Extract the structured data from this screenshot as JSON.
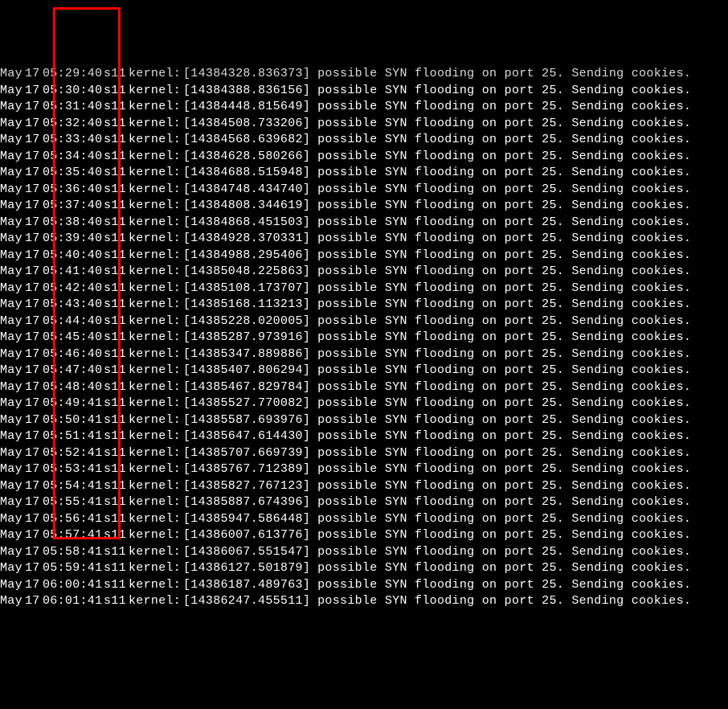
{
  "highlight_color": "#ff0000",
  "log_entries": [
    {
      "month": "May",
      "day": "17",
      "time": "05:29:40",
      "host": "s11",
      "src": "kernel:",
      "ts": "[14384328.836373]",
      "msg": "possible SYN flooding on port 25. Sending cookies."
    },
    {
      "month": "May",
      "day": "17",
      "time": "05:30:40",
      "host": "s11",
      "src": "kernel:",
      "ts": "[14384388.836156]",
      "msg": "possible SYN flooding on port 25. Sending cookies."
    },
    {
      "month": "May",
      "day": "17",
      "time": "05:31:40",
      "host": "s11",
      "src": "kernel:",
      "ts": "[14384448.815649]",
      "msg": "possible SYN flooding on port 25. Sending cookies."
    },
    {
      "month": "May",
      "day": "17",
      "time": "05:32:40",
      "host": "s11",
      "src": "kernel:",
      "ts": "[14384508.733206]",
      "msg": "possible SYN flooding on port 25. Sending cookies."
    },
    {
      "month": "May",
      "day": "17",
      "time": "05:33:40",
      "host": "s11",
      "src": "kernel:",
      "ts": "[14384568.639682]",
      "msg": "possible SYN flooding on port 25. Sending cookies."
    },
    {
      "month": "May",
      "day": "17",
      "time": "05:34:40",
      "host": "s11",
      "src": "kernel:",
      "ts": "[14384628.580266]",
      "msg": "possible SYN flooding on port 25. Sending cookies."
    },
    {
      "month": "May",
      "day": "17",
      "time": "05:35:40",
      "host": "s11",
      "src": "kernel:",
      "ts": "[14384688.515948]",
      "msg": "possible SYN flooding on port 25. Sending cookies."
    },
    {
      "month": "May",
      "day": "17",
      "time": "05:36:40",
      "host": "s11",
      "src": "kernel:",
      "ts": "[14384748.434740]",
      "msg": "possible SYN flooding on port 25. Sending cookies."
    },
    {
      "month": "May",
      "day": "17",
      "time": "05:37:40",
      "host": "s11",
      "src": "kernel:",
      "ts": "[14384808.344619]",
      "msg": "possible SYN flooding on port 25. Sending cookies."
    },
    {
      "month": "May",
      "day": "17",
      "time": "05:38:40",
      "host": "s11",
      "src": "kernel:",
      "ts": "[14384868.451503]",
      "msg": "possible SYN flooding on port 25. Sending cookies."
    },
    {
      "month": "May",
      "day": "17",
      "time": "05:39:40",
      "host": "s11",
      "src": "kernel:",
      "ts": "[14384928.370331]",
      "msg": "possible SYN flooding on port 25. Sending cookies."
    },
    {
      "month": "May",
      "day": "17",
      "time": "05:40:40",
      "host": "s11",
      "src": "kernel:",
      "ts": "[14384988.295406]",
      "msg": "possible SYN flooding on port 25. Sending cookies."
    },
    {
      "month": "May",
      "day": "17",
      "time": "05:41:40",
      "host": "s11",
      "src": "kernel:",
      "ts": "[14385048.225863]",
      "msg": "possible SYN flooding on port 25. Sending cookies."
    },
    {
      "month": "May",
      "day": "17",
      "time": "05:42:40",
      "host": "s11",
      "src": "kernel:",
      "ts": "[14385108.173707]",
      "msg": "possible SYN flooding on port 25. Sending cookies."
    },
    {
      "month": "May",
      "day": "17",
      "time": "05:43:40",
      "host": "s11",
      "src": "kernel:",
      "ts": "[14385168.113213]",
      "msg": "possible SYN flooding on port 25. Sending cookies."
    },
    {
      "month": "May",
      "day": "17",
      "time": "05:44:40",
      "host": "s11",
      "src": "kernel:",
      "ts": "[14385228.020005]",
      "msg": "possible SYN flooding on port 25. Sending cookies."
    },
    {
      "month": "May",
      "day": "17",
      "time": "05:45:40",
      "host": "s11",
      "src": "kernel:",
      "ts": "[14385287.973916]",
      "msg": "possible SYN flooding on port 25. Sending cookies."
    },
    {
      "month": "May",
      "day": "17",
      "time": "05:46:40",
      "host": "s11",
      "src": "kernel:",
      "ts": "[14385347.889886]",
      "msg": "possible SYN flooding on port 25. Sending cookies."
    },
    {
      "month": "May",
      "day": "17",
      "time": "05:47:40",
      "host": "s11",
      "src": "kernel:",
      "ts": "[14385407.806294]",
      "msg": "possible SYN flooding on port 25. Sending cookies."
    },
    {
      "month": "May",
      "day": "17",
      "time": "05:48:40",
      "host": "s11",
      "src": "kernel:",
      "ts": "[14385467.829784]",
      "msg": "possible SYN flooding on port 25. Sending cookies."
    },
    {
      "month": "May",
      "day": "17",
      "time": "05:49:41",
      "host": "s11",
      "src": "kernel:",
      "ts": "[14385527.770082]",
      "msg": "possible SYN flooding on port 25. Sending cookies."
    },
    {
      "month": "May",
      "day": "17",
      "time": "05:50:41",
      "host": "s11",
      "src": "kernel:",
      "ts": "[14385587.693976]",
      "msg": "possible SYN flooding on port 25. Sending cookies."
    },
    {
      "month": "May",
      "day": "17",
      "time": "05:51:41",
      "host": "s11",
      "src": "kernel:",
      "ts": "[14385647.614430]",
      "msg": "possible SYN flooding on port 25. Sending cookies."
    },
    {
      "month": "May",
      "day": "17",
      "time": "05:52:41",
      "host": "s11",
      "src": "kernel:",
      "ts": "[14385707.669739]",
      "msg": "possible SYN flooding on port 25. Sending cookies."
    },
    {
      "month": "May",
      "day": "17",
      "time": "05:53:41",
      "host": "s11",
      "src": "kernel:",
      "ts": "[14385767.712389]",
      "msg": "possible SYN flooding on port 25. Sending cookies."
    },
    {
      "month": "May",
      "day": "17",
      "time": "05:54:41",
      "host": "s11",
      "src": "kernel:",
      "ts": "[14385827.767123]",
      "msg": "possible SYN flooding on port 25. Sending cookies."
    },
    {
      "month": "May",
      "day": "17",
      "time": "05:55:41",
      "host": "s11",
      "src": "kernel:",
      "ts": "[14385887.674396]",
      "msg": "possible SYN flooding on port 25. Sending cookies."
    },
    {
      "month": "May",
      "day": "17",
      "time": "05:56:41",
      "host": "s11",
      "src": "kernel:",
      "ts": "[14385947.586448]",
      "msg": "possible SYN flooding on port 25. Sending cookies."
    },
    {
      "month": "May",
      "day": "17",
      "time": "05:57:41",
      "host": "s11",
      "src": "kernel:",
      "ts": "[14386007.613776]",
      "msg": "possible SYN flooding on port 25. Sending cookies."
    },
    {
      "month": "May",
      "day": "17",
      "time": "05:58:41",
      "host": "s11",
      "src": "kernel:",
      "ts": "[14386067.551547]",
      "msg": "possible SYN flooding on port 25. Sending cookies."
    },
    {
      "month": "May",
      "day": "17",
      "time": "05:59:41",
      "host": "s11",
      "src": "kernel:",
      "ts": "[14386127.501879]",
      "msg": "possible SYN flooding on port 25. Sending cookies."
    },
    {
      "month": "May",
      "day": "17",
      "time": "06:00:41",
      "host": "s11",
      "src": "kernel:",
      "ts": "[14386187.489763]",
      "msg": "possible SYN flooding on port 25. Sending cookies."
    },
    {
      "month": "May",
      "day": "17",
      "time": "06:01:41",
      "host": "s11",
      "src": "kernel:",
      "ts": "[14386247.455511]",
      "msg": "possible SYN flooding on port 25. Sending cookies."
    }
  ]
}
